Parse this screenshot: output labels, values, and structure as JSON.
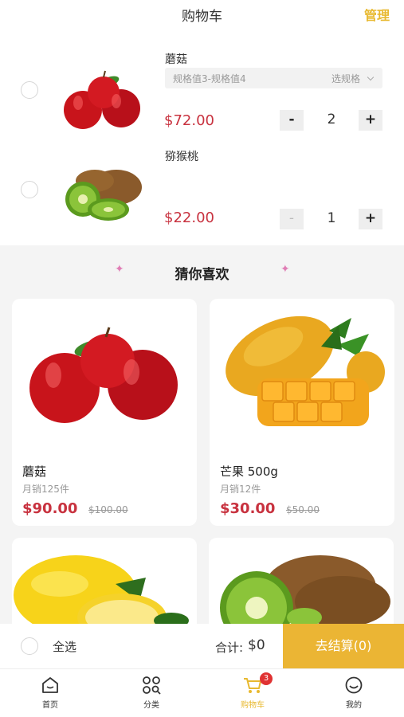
{
  "header": {
    "title": "购物车",
    "manage": "管理"
  },
  "cart": {
    "items": [
      {
        "name": "蘑菇",
        "spec": "规格值3-规格值4",
        "spec_choose": "选规格",
        "price": "$72.00",
        "minus": "-",
        "qty": "2",
        "plus": "+",
        "image": "apple-image"
      },
      {
        "name": "猕猴桃",
        "price": "$22.00",
        "minus": "-",
        "qty": "1",
        "plus": "+",
        "image": "kiwi-image"
      }
    ]
  },
  "recommend": {
    "title": "猜你喜欢",
    "products": [
      {
        "name": "蘑菇",
        "sales": "月销125件",
        "price": "$90.00",
        "old_price": "$100.00",
        "image": "apple-image"
      },
      {
        "name": "芒果 500g",
        "sales": "月销12件",
        "price": "$30.00",
        "old_price": "$50.00",
        "image": "mango-image"
      },
      {
        "image": "lemon-image"
      },
      {
        "image": "kiwi-image"
      }
    ]
  },
  "checkout": {
    "select_all": "全选",
    "total_label": "合计:",
    "total_value": "$0",
    "button": "去结算(0)"
  },
  "tabbar": {
    "tabs": [
      {
        "label": "首页",
        "icon": "home-icon"
      },
      {
        "label": "分类",
        "icon": "category-icon"
      },
      {
        "label": "购物车",
        "icon": "cart-icon",
        "badge": "3"
      },
      {
        "label": "我的",
        "icon": "profile-icon"
      }
    ],
    "active_index": 2
  },
  "colors": {
    "accent": "#ebb534",
    "price": "#c8323f",
    "badge": "#e03232"
  }
}
